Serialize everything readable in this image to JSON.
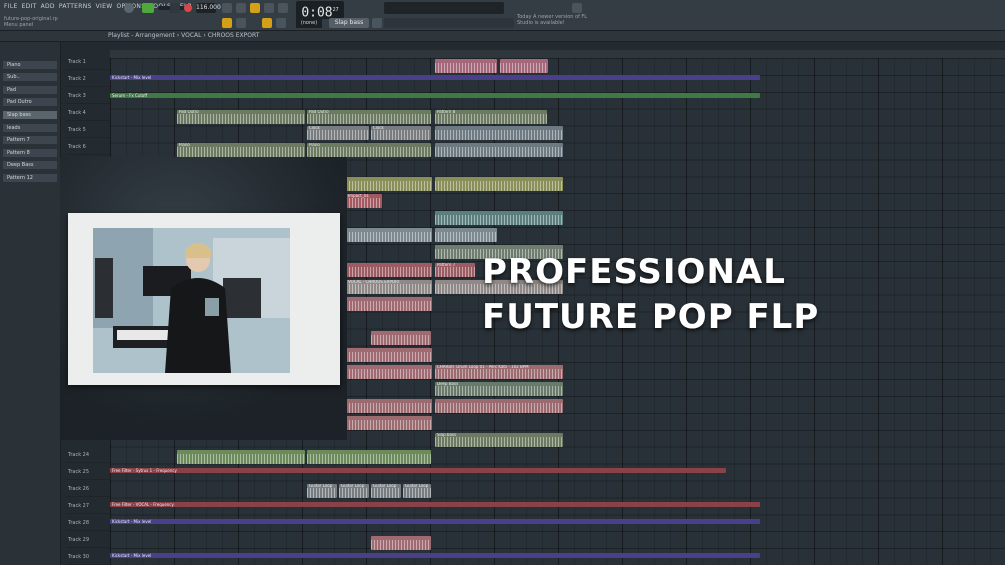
{
  "menu": [
    "FILE",
    "EDIT",
    "ADD",
    "PATTERNS",
    "VIEW",
    "OPTIONS",
    "TOOLS",
    "HELP"
  ],
  "file": {
    "name": "future-pop-original.rp",
    "panel": "Menu panel"
  },
  "transport": {
    "tempo": "116.000",
    "time": "0:08",
    "time_sub": "27",
    "mode": "(none)",
    "pattern": "Slap bass"
  },
  "news": {
    "line1": "Today  A newer version of FL",
    "line2": "Studio is available!"
  },
  "playlist": {
    "breadcrumb": "Playlist - Arrangement › VOCAL › CHROOS EXPORT"
  },
  "channels": [
    "Piano",
    "Sub..",
    "Pad",
    "Pad Outro",
    "Slap bass",
    "leads",
    "Pattern 7",
    "Pattern 8",
    "Deep Bass",
    "Pattern 12"
  ],
  "tracks": [
    "Track 1",
    "Track 2",
    "Track 3",
    "Track 4",
    "Track 5",
    "Track 6",
    "Track 24",
    "Track 25",
    "Track 26",
    "Track 27",
    "Track 28",
    "Track 29",
    "Track 30"
  ],
  "clips": {
    "kickstart": "Kickstart - Mix level",
    "serum": "Serum - Fx Cutoff",
    "pad_outro": "Pad Outro",
    "pattern8": "Pattern 8",
    "clock": "Clock",
    "piano": "Piano",
    "impact": "Impact_01",
    "vocal": "VOCAL - CHROOS EXPORT",
    "pattern7": "Pattern 7",
    "drum_loop": "CHARDIT Drum Loop 01 - Perc Kats - 102 BPM",
    "deep_bass": "Deep Bass",
    "slap_bass": "Slap bass",
    "guitar_loop": "Guitar Loop",
    "free_filter1": "Free Filter - Sytrus 1 - Frequency",
    "free_filter2": "Free Filter - VOCAL - Frequency"
  },
  "headline": {
    "line1": "PROFESSIONAL",
    "line2": "FUTURE POP FLP"
  }
}
